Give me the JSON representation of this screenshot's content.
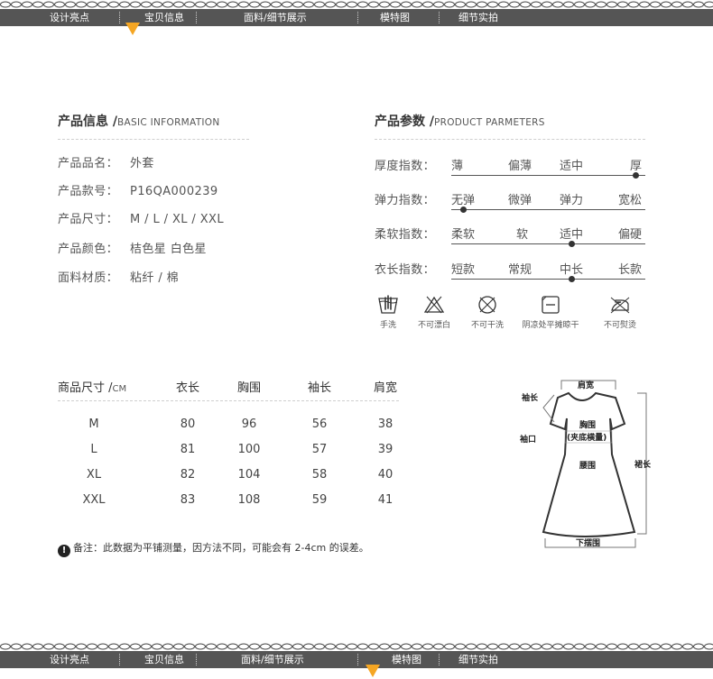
{
  "nav_top": {
    "items": [
      "设计亮点",
      "宝贝信息",
      "面料/细节展示",
      "模特图",
      "细节实拍"
    ],
    "active_index": 1
  },
  "nav_bottom": {
    "items": [
      "设计亮点",
      "宝贝信息",
      "面料/细节展示",
      "模特图",
      "细节实拍"
    ],
    "active_index": 3
  },
  "product_info": {
    "title": "产品信息 /",
    "subtitle": "BASIC INFORMATION",
    "rows": [
      {
        "label": "产品品名：",
        "value": "外套"
      },
      {
        "label": "产品款号：",
        "value": "P16QA000239"
      },
      {
        "label": "产品尺寸：",
        "value": "M / L / XL / XXL"
      },
      {
        "label": "产品颜色：",
        "value": "桔色星 白色星"
      },
      {
        "label": "面料材质：",
        "value": "粘纤 / 棉"
      }
    ]
  },
  "parameters": {
    "title": "产品参数 /",
    "subtitle": "PRODUCT PARMETERS",
    "rows": [
      {
        "label": "厚度指数：",
        "options": [
          "薄",
          "偏薄",
          "适中",
          "厚"
        ],
        "selected": 3
      },
      {
        "label": "弹力指数：",
        "options": [
          "无弹",
          "微弹",
          "弹力",
          "宽松"
        ],
        "selected": 0
      },
      {
        "label": "柔软指数：",
        "options": [
          "柔软",
          "软",
          "适中",
          "偏硬"
        ],
        "selected": 2
      },
      {
        "label": "衣长指数：",
        "options": [
          "短款",
          "常规",
          "中长",
          "长款"
        ],
        "selected": 2
      }
    ]
  },
  "care": {
    "items": [
      {
        "icon": "hand-wash-icon",
        "label": "手洗"
      },
      {
        "icon": "no-bleach-icon",
        "label": "不可漂白"
      },
      {
        "icon": "no-dry-clean-icon",
        "label": "不可干洗"
      },
      {
        "icon": "shade-flat-dry-icon",
        "label": "阴凉处平摊晾干"
      },
      {
        "icon": "no-iron-icon",
        "label": "不可熨烫"
      }
    ]
  },
  "size_table": {
    "header": {
      "size": "商品尺寸 /",
      "unit": "CM",
      "cols": [
        "衣长",
        "胸围",
        "袖长",
        "肩宽"
      ]
    },
    "rows": [
      {
        "size": "M",
        "values": [
          "80",
          "96",
          "56",
          "38"
        ]
      },
      {
        "size": "L",
        "values": [
          "81",
          "100",
          "57",
          "39"
        ]
      },
      {
        "size": "XL",
        "values": [
          "82",
          "104",
          "58",
          "40"
        ]
      },
      {
        "size": "XXL",
        "values": [
          "83",
          "108",
          "59",
          "41"
        ]
      }
    ]
  },
  "note": {
    "icon": "exclamation-icon",
    "text": "备注：此数据为平铺测量，因方法不同，可能会有 2-4cm 的误差。"
  },
  "diagram": {
    "labels": {
      "shoulder": "肩宽",
      "sleeve": "袖长",
      "cuff": "袖口",
      "chest": "胸围",
      "chest_note": "(夹底横量)",
      "waist": "腰围",
      "length": "裙长",
      "hem": "下摆围"
    }
  },
  "colors": {
    "nav_bg": "#555555",
    "nav_marker": "#f5a623",
    "text": "#555555"
  }
}
